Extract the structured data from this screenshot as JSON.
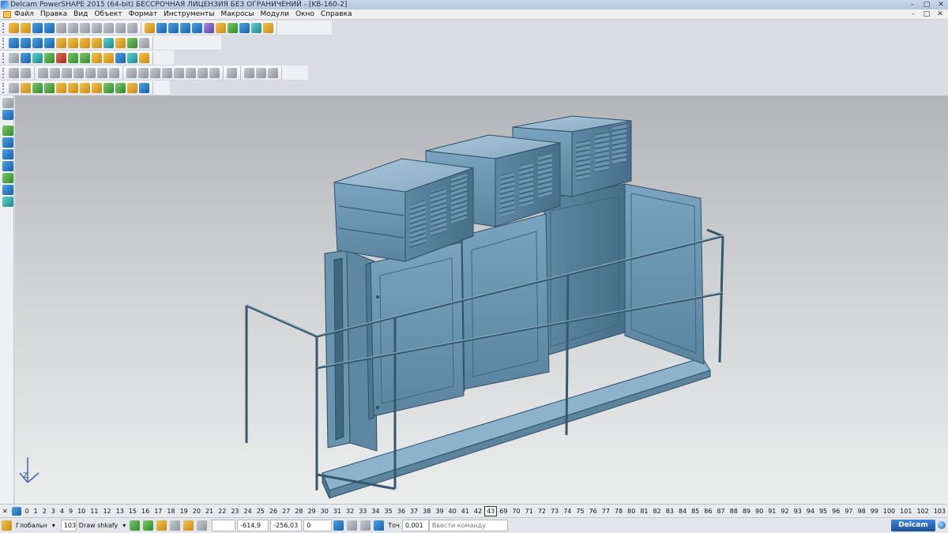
{
  "window": {
    "title": "Delcam PowerSHAPE 2015 (64-bit) БЕССРОЧНАЯ ЛИЦЕНЗИЯ БЕЗ ОГРАНИЧЕНИЙ - [KB-160-2]",
    "controls": [
      "–",
      "□",
      "✕"
    ]
  },
  "menu": {
    "items": [
      "Файл",
      "Правка",
      "Вид",
      "Объект",
      "Формат",
      "Инструменты",
      "Макросы",
      "Модули",
      "Окно",
      "Справка"
    ],
    "doc_controls": [
      "–",
      "□",
      "✕"
    ]
  },
  "levels": {
    "numbers": [
      "0",
      "1",
      "2",
      "3",
      "4",
      "9",
      "10",
      "11",
      "12",
      "13",
      "15",
      "16",
      "17",
      "18",
      "19",
      "20",
      "21",
      "22",
      "23",
      "24",
      "25",
      "26",
      "27",
      "28",
      "29",
      "30",
      "31",
      "32",
      "33",
      "34",
      "35",
      "36",
      "37",
      "38",
      "39",
      "40",
      "41",
      "42",
      "43",
      "69",
      "70",
      "71",
      "72",
      "73",
      "74",
      "75",
      "76",
      "77",
      "78",
      "80",
      "81",
      "82",
      "83",
      "84",
      "85",
      "86",
      "87",
      "88",
      "89",
      "90",
      "91",
      "92",
      "93",
      "94",
      "95",
      "96",
      "97",
      "98",
      "99",
      "100",
      "101",
      "102",
      "103"
    ],
    "active": "43"
  },
  "status": {
    "workplane": "Глобальн",
    "level_number": "103",
    "level_name": "Draw shkafy",
    "x": "-614,9",
    "y": "-256,03",
    "z": "0",
    "tolerance_label": "Точ",
    "tolerance_value": "0,001",
    "command_placeholder": "Ввести команду",
    "brand": "Delcam"
  },
  "viewport": {
    "axis_label": "Z",
    "colors": {
      "model": "#6f9ab6",
      "model_dark": "#4d7792",
      "model_light": "#9ec0d6",
      "edge": "#2f4f66"
    }
  }
}
